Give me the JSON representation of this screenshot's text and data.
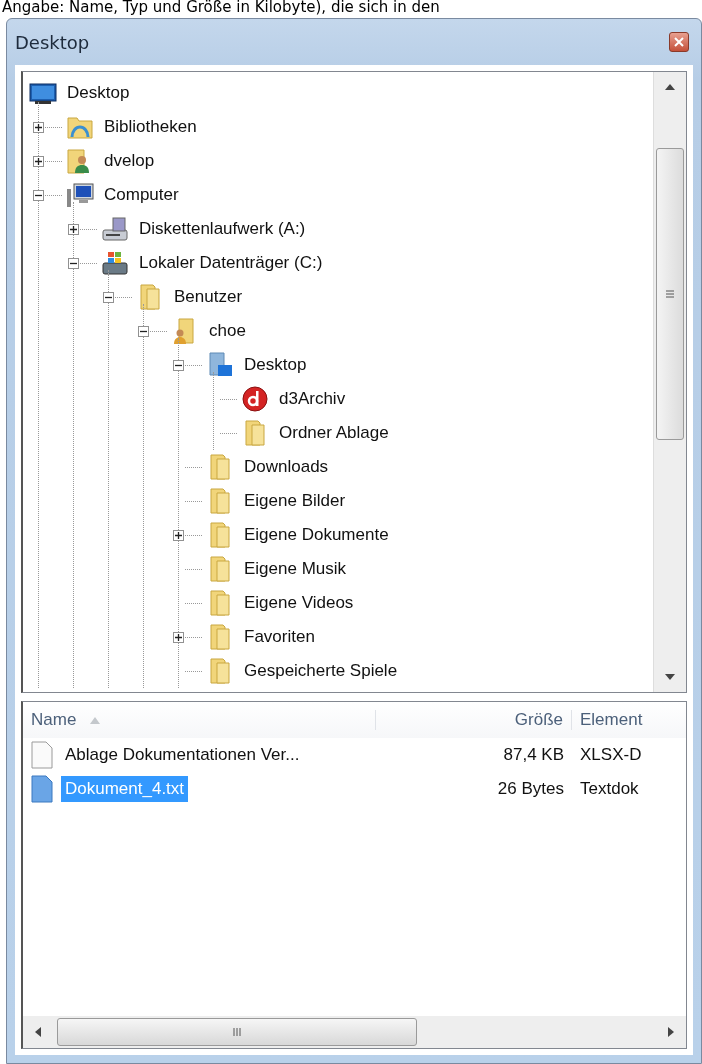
{
  "caption": "Angabe: Name, Typ und Größe in Kilobyte), die sich in den",
  "window": {
    "title": "Desktop"
  },
  "tree": [
    {
      "label": "Desktop",
      "kind": "desktop",
      "children": [
        {
          "label": "Bibliotheken",
          "kind": "library",
          "expanded": false
        },
        {
          "label": "dvelop",
          "kind": "user",
          "expanded": false
        },
        {
          "label": "Computer",
          "kind": "computer",
          "expanded": true,
          "children": [
            {
              "label": "Diskettenlaufwerk (A:)",
              "kind": "floppy",
              "expanded": false
            },
            {
              "label": "Lokaler Datenträger (C:)",
              "kind": "drive",
              "expanded": true,
              "children": [
                {
                  "label": "Benutzer",
                  "kind": "folder",
                  "expanded": true,
                  "children": [
                    {
                      "label": "choe",
                      "kind": "userfolder",
                      "expanded": true,
                      "children": [
                        {
                          "label": "Desktop",
                          "kind": "desktopfolder",
                          "expanded": true,
                          "children": [
                            {
                              "label": "d3Archiv",
                              "kind": "app"
                            },
                            {
                              "label": "Ordner Ablage",
                              "kind": "folder"
                            }
                          ]
                        },
                        {
                          "label": "Downloads",
                          "kind": "folder"
                        },
                        {
                          "label": "Eigene Bilder",
                          "kind": "folder"
                        },
                        {
                          "label": "Eigene Dokumente",
                          "kind": "folder",
                          "expanded": false
                        },
                        {
                          "label": "Eigene Musik",
                          "kind": "folder"
                        },
                        {
                          "label": "Eigene Videos",
                          "kind": "folder"
                        },
                        {
                          "label": "Favoriten",
                          "kind": "folder",
                          "expanded": false
                        },
                        {
                          "label": "Gespeicherte Spiele",
                          "kind": "folder"
                        }
                      ]
                    }
                  ]
                }
              ]
            }
          ]
        }
      ]
    }
  ],
  "list": {
    "columns": [
      {
        "label": "Name",
        "sorted": true
      },
      {
        "label": "Größe",
        "sorted": false
      },
      {
        "label": "Element",
        "sorted": false
      }
    ],
    "rows": [
      {
        "name": "Ablage Dokumentationen Ver...",
        "size": "87,4 KB",
        "type": "XLSX-D",
        "selected": false
      },
      {
        "name": "Dokument_4.txt",
        "size": "26 Bytes",
        "type": "Textdok",
        "selected": true
      }
    ]
  }
}
